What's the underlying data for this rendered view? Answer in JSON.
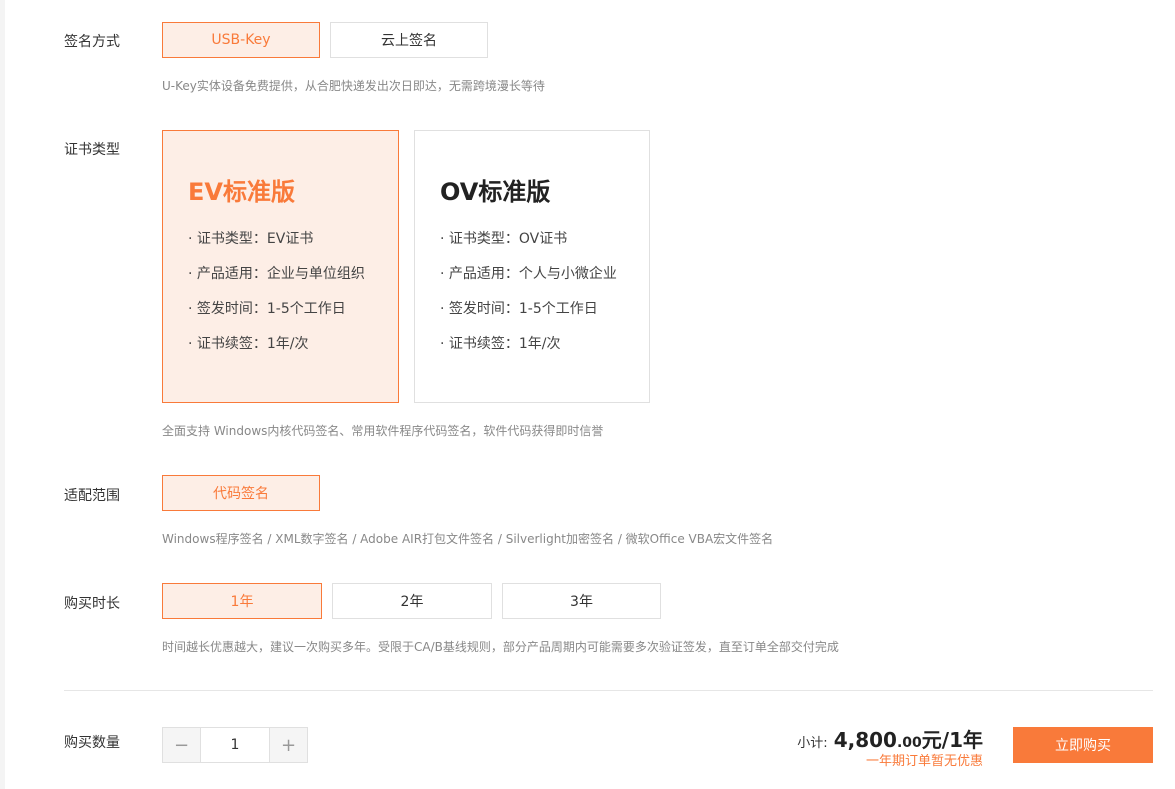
{
  "sign_method": {
    "label": "签名方式",
    "options": [
      "USB-Key",
      "云上签名"
    ],
    "selected": "USB-Key",
    "hint": "U-Key实体设备免费提供，从合肥快递发出次日即达，无需跨境漫长等待"
  },
  "cert_type": {
    "label": "证书类型",
    "selected": "EV标准版",
    "cards": [
      {
        "title": "EV标准版",
        "features": [
          "· 证书类型：EV证书",
          "· 产品适用：企业与单位组织",
          "· 签发时间：1-5个工作日",
          "· 证书续签：1年/次"
        ]
      },
      {
        "title": "OV标准版",
        "features": [
          "· 证书类型：OV证书",
          "· 产品适用：个人与小微企业",
          "· 签发时间：1-5个工作日",
          "· 证书续签：1年/次"
        ]
      }
    ],
    "hint": "全面支持 Windows内核代码签名、常用软件程序代码签名，软件代码获得即时信誉"
  },
  "scope": {
    "label": "适配范围",
    "options": [
      "代码签名"
    ],
    "selected": "代码签名",
    "hint": "Windows程序签名 / XML数字签名 / Adobe AIR打包文件签名 / Silverlight加密签名 / 微软Office VBA宏文件签名"
  },
  "duration": {
    "label": "购买时长",
    "options": [
      "1年",
      "2年",
      "3年"
    ],
    "selected": "1年",
    "hint": "时间越长优惠越大，建议一次购买多年。受限于CA/B基线规则，部分产品周期内可能需要多次验证签发，直至订单全部交付完成"
  },
  "quantity": {
    "label": "购买数量",
    "value": "1",
    "minus": "−",
    "plus": "+"
  },
  "summary": {
    "subtotal_label": "小计:",
    "price_int": "4,800",
    "price_dec": ".00",
    "price_unit": "元/1年",
    "discount_note": "一年期订单暂无优惠",
    "buy_label": "立即购买"
  },
  "colors": {
    "accent": "#f97a3a",
    "selected_bg": "#fdeee6"
  }
}
